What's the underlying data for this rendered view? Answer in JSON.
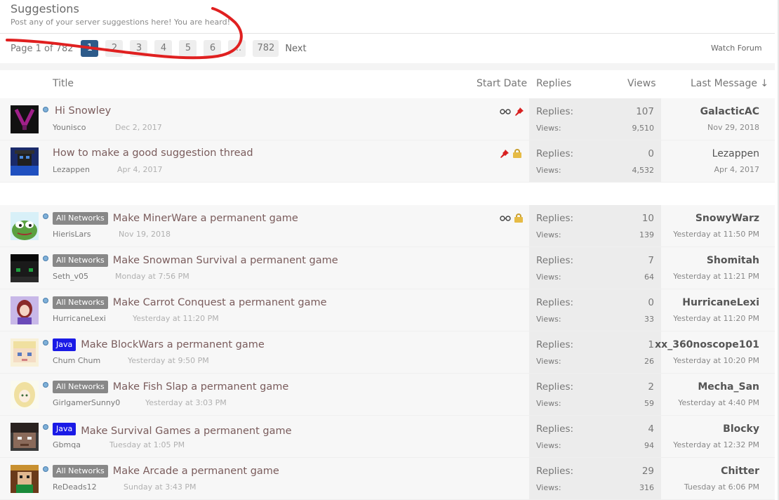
{
  "forum": {
    "title": "Suggestions",
    "description": "Post any of your server suggestions here! You are heard!",
    "page_label": "Page 1 of 782",
    "pages": [
      "1",
      "2",
      "3",
      "4",
      "5",
      "6",
      "...",
      "782"
    ],
    "next_label": "Next",
    "watch_label": "Watch Forum"
  },
  "columns": {
    "title": "Title",
    "start_date": "Start Date",
    "replies": "Replies",
    "views": "Views",
    "last_message": "Last Message ↓"
  },
  "labels": {
    "replies": "Replies:",
    "views": "Views:"
  },
  "sticky_threads": [
    {
      "title": "Hi Snowley",
      "author": "Younisco",
      "date": "Dec 2, 2017",
      "replies": "107",
      "views": "9,510",
      "last_user": "GalacticAC",
      "last_date": "Nov 29, 2018",
      "icons": [
        "glasses-icon",
        "pin-icon"
      ]
    },
    {
      "title": "How to make a good suggestion thread",
      "author": "Lezappen",
      "date": "Apr 4, 2017",
      "replies": "0",
      "views": "4,532",
      "last_user": "Lezappen",
      "last_date": "Apr 4, 2017",
      "icons": [
        "pin-icon",
        "lock-icon"
      ]
    }
  ],
  "threads": [
    {
      "prefix": "All Networks",
      "title": "Make MinerWare a permanent game",
      "author": "HierisLars",
      "date": "Nov 19, 2018",
      "replies": "10",
      "views": "139",
      "last_user": "SnowyWarz",
      "last_date": "Yesterday at 11:50 PM",
      "icons": [
        "glasses-icon",
        "lock-icon"
      ]
    },
    {
      "prefix": "All Networks",
      "title": "Make Snowman Survival a permanent game",
      "author": "Seth_v05",
      "date": "Monday at 7:56 PM",
      "replies": "7",
      "views": "64",
      "last_user": "Shomitah",
      "last_date": "Yesterday at 11:21 PM",
      "icons": []
    },
    {
      "prefix": "All Networks",
      "title": "Make Carrot Conquest a permanent game",
      "author": "HurricaneLexi",
      "date": "Yesterday at 11:20 PM",
      "replies": "0",
      "views": "33",
      "last_user": "HurricaneLexi",
      "last_date": "Yesterday at 11:20 PM",
      "icons": []
    },
    {
      "prefix": "Java",
      "title": "Make BlockWars a permanent game",
      "author": "Chum Chum",
      "date": "Yesterday at 9:50 PM",
      "replies": "1",
      "views": "26",
      "last_user": "xx_360noscope101",
      "last_date": "Yesterday at 10:20 PM",
      "icons": []
    },
    {
      "prefix": "All Networks",
      "title": "Make Fish Slap a permanent game",
      "author": "GirlgamerSunny0",
      "date": "Yesterday at 3:03 PM",
      "replies": "2",
      "views": "59",
      "last_user": "Mecha_San",
      "last_date": "Yesterday at 4:40 PM",
      "icons": []
    },
    {
      "prefix": "Java",
      "title": "Make Survival Games a permanent game",
      "author": "Gbmqa",
      "date": "Tuesday at 1:05 PM",
      "replies": "4",
      "views": "94",
      "last_user": "Blocky",
      "last_date": "Yesterday at 12:32 PM",
      "icons": []
    },
    {
      "prefix": "All Networks",
      "title": "Make Arcade a permanent game",
      "author": "ReDeads12",
      "date": "Sunday at 3:43 PM",
      "replies": "29",
      "views": "316",
      "last_user": "Chitter",
      "last_date": "Tuesday at 6:06 PM",
      "icons": []
    }
  ],
  "colors": {
    "accent": "#2d5b8a",
    "prefix_all_networks": "#888888",
    "prefix_java": "#1a1ae6",
    "annotation": "#e02020"
  }
}
